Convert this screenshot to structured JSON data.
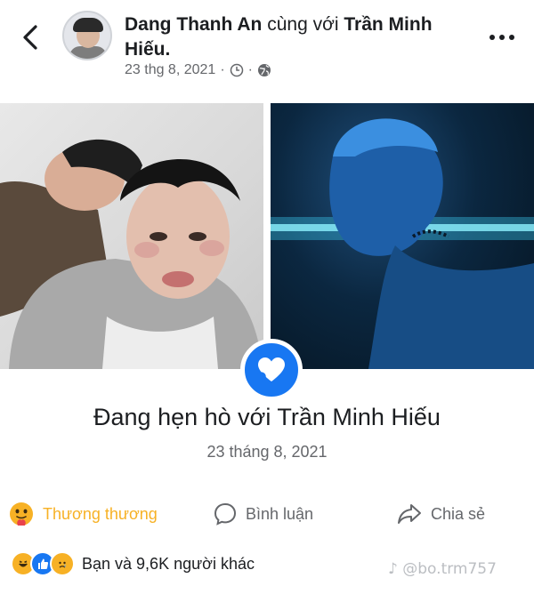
{
  "post": {
    "author": "Dang Thanh An",
    "connector": "cùng với",
    "tagged": "Trần Minh Hiếu.",
    "date": "23 thg 8, 2021",
    "separator": "·"
  },
  "life_event": {
    "title": "Đang hẹn hò với Trần Minh Hiếu",
    "date": "23 tháng 8, 2021",
    "icon": "heart-icon"
  },
  "actions": {
    "react": "Thương thương",
    "comment": "Bình luận",
    "share": "Chia sẻ"
  },
  "reactions": {
    "summary": "Bạn và 9,6K người khác"
  },
  "watermark": "@bo.trm757",
  "colors": {
    "facebook_blue": "#1877f2",
    "care_yellow": "#f7b125",
    "secondary_text": "#65676b"
  }
}
